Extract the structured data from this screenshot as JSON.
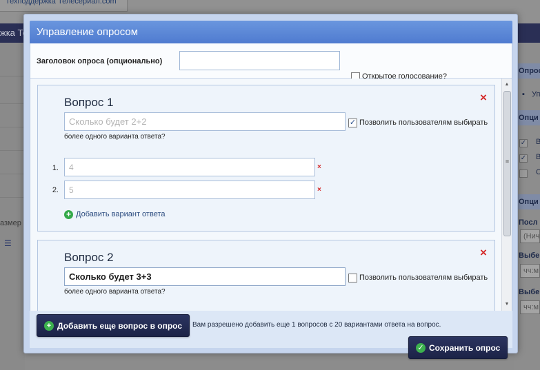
{
  "background": {
    "top_tab_text": "Техподдержка Телесериал.com",
    "nav_text": "жка Теле",
    "left_text": "азмер",
    "left_icon": "list-icon",
    "right_labels": [
      "Опрос",
      "Опци",
      "Опци",
      "Посл",
      "Выбе",
      "Выбе"
    ],
    "right_link": "Уп",
    "right_chk_labels": [
      "В",
      "В",
      "С"
    ],
    "right_select": "(Нич",
    "right_time": "чч:м"
  },
  "modal": {
    "title": "Управление опросом",
    "poll_title_label": "Заголовок опроса (опционально)",
    "poll_title_value": "",
    "open_vote_label": "Открытое голосование?",
    "open_vote_checked": false
  },
  "questions": [
    {
      "title": "Вопрос 1",
      "text": "Сколько будет 2+2",
      "multi_label": "Позволить пользователям выбирать",
      "multi_label_cont": "более одного варианта ответа?",
      "multi_checked": true,
      "answers": [
        {
          "num": "1.",
          "value": "4"
        },
        {
          "num": "2.",
          "value": "5"
        }
      ],
      "add_answer_label": "Добавить вариант ответа",
      "delete_mark": "×"
    },
    {
      "title": "Вопрос 2",
      "text": "Сколько будет 3+3",
      "multi_label": "Позволить пользователям выбирать",
      "multi_label_cont": "более одного варианта ответа?",
      "multi_checked": false,
      "delete_mark": "×"
    }
  ],
  "footer": {
    "add_question_label": "Добавить еще вопрос в опрос",
    "note": "Вам разрешено добавить еще 1 вопросов с 20 вариантами ответа на вопрос.",
    "save_label": "Сохранить опрос"
  },
  "colors": {
    "title_bar": "#5a86d6",
    "dark_button": "#1f2650",
    "delete": "#d42a2a",
    "add": "#34a94a"
  }
}
